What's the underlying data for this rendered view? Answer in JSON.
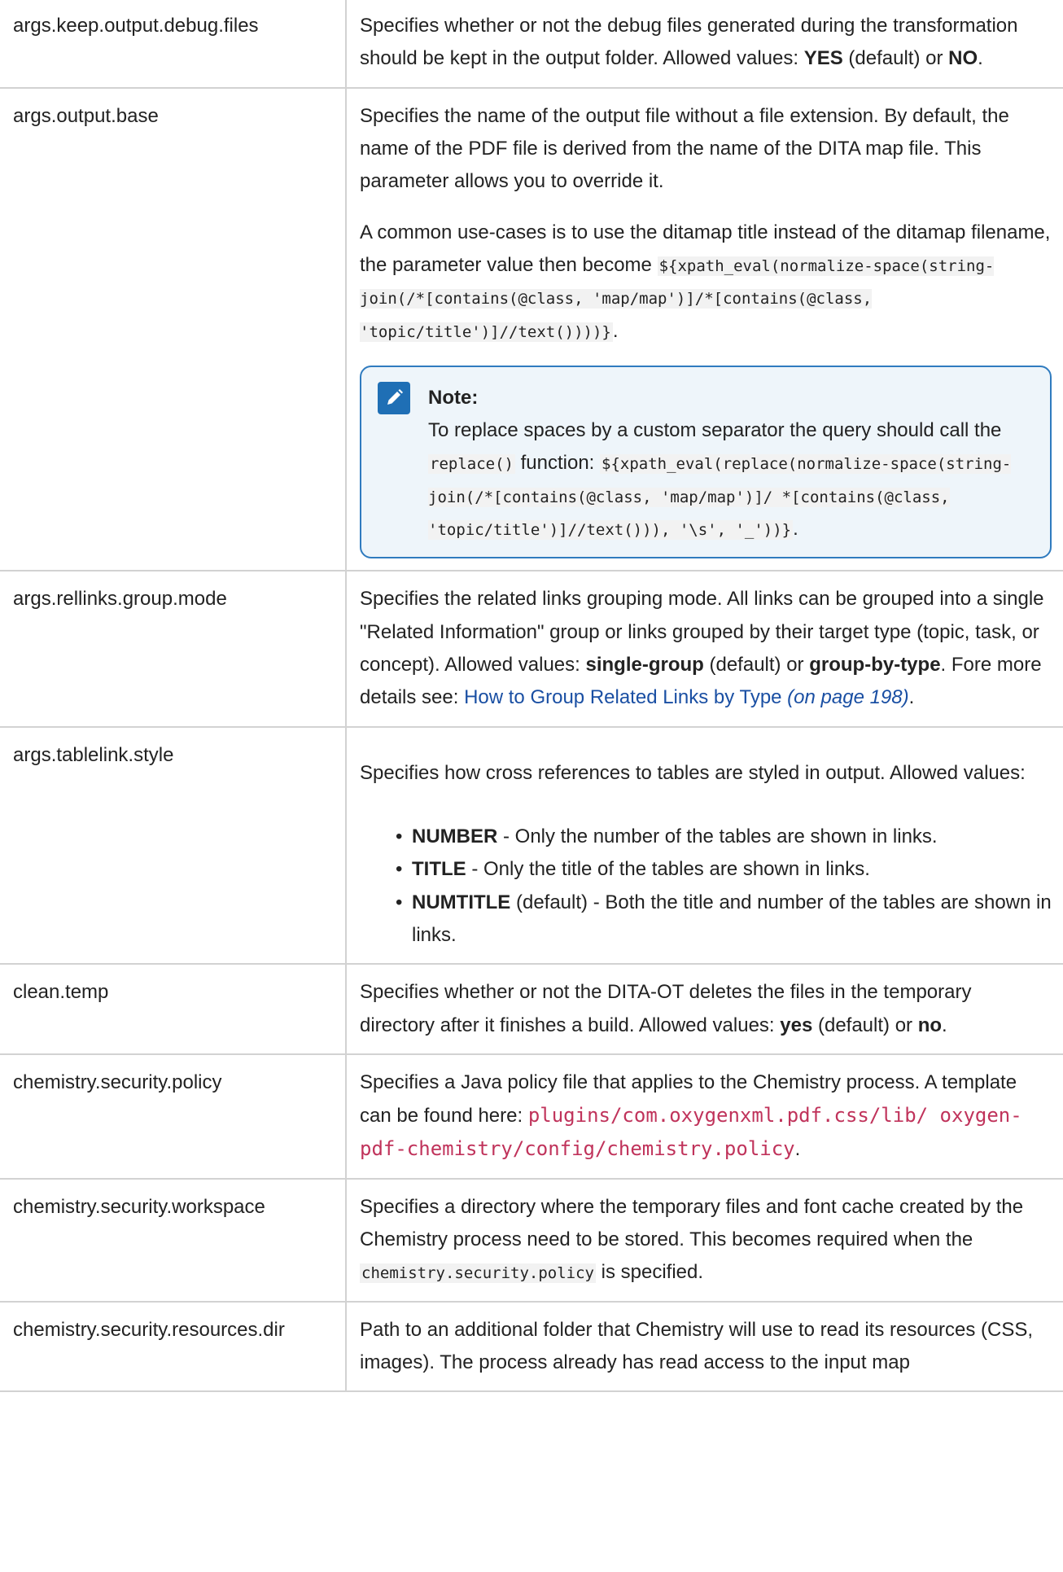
{
  "rows": [
    {
      "name": "args.keep.output.debug.files",
      "desc_pre": "Specifies whether or not the debug files generated during the transfor­mation should be kept in the output folder. Allowed values: ",
      "v1": "YES",
      "mid": " (default) or ",
      "v2": "NO",
      "end": "."
    },
    {
      "name": "args.output.base",
      "p1": "Specifies the name of the output file without a file extension. By default, the name of the PDF file is derived from the name of the DITA map file. This parameter allows you to override it.",
      "p2_text": "A common use-cases is to use the ditamap title instead of the dita­map filename, the parameter value then become ",
      "p2_code": "${xpath_eval(normal­ize-space(string-join(/*[contains(@class, 'map/map')]/*[contain­s(@class, 'topic/title')]//text())))}",
      "p2_end": ".",
      "note": {
        "title": "Note:",
        "text1": "To replace spaces by a custom separator the query should call the ",
        "code1": "replace()",
        "text2": " function: ",
        "code2": "${xpath_eval(replace(normal­ize-space(string-join(/*[contains(@class, 'map/map')]/ *[contains(@class, 'topic/title')]//text())), '\\s', '_'))}",
        "end": "."
      }
    },
    {
      "name": "args.rellinks.group.mode",
      "t1": "Specifies the related links grouping mode. All links can be grouped into a single \"Related Information\" group or links grouped by their target type (topic, task, or concept). Allowed values: ",
      "v1": "single-group",
      "t2": " (default) or ",
      "v2": "group-by-type",
      "t3": ". Fore more details see: ",
      "link": "How to Group Related Links by Type",
      "page": " (on page 198)",
      "end": "."
    },
    {
      "name": "args.tablelink.style",
      "intro": "Specifies how cross references to tables are styled in output. Allowed values:",
      "items": [
        {
          "key": "NUMBER",
          "text": " - Only the number of the tables are shown in links."
        },
        {
          "key": "TITLE",
          "text": " - Only the title of the tables are shown in links."
        },
        {
          "key": "NUMTITLE",
          "text": " (default) - Both the title and number of the tables are shown in links."
        }
      ]
    },
    {
      "name": "clean.temp",
      "t1": "Specifies whether or not the DITA-OT deletes the files in the temporary directory after it finishes a build. Allowed values: ",
      "v1": "yes",
      "t2": " (default) or ",
      "v2": "no",
      "end": "."
    },
    {
      "name": "chemistry.security.policy",
      "t1": "Specifies a Java policy file that applies to the Chemistry process. A tem­plate can be found here: ",
      "path": "plugins/com.oxygenxml.pdf.css/lib/ oxygen-pdf-chemistry/config/chemistry.policy",
      "end": "."
    },
    {
      "name": "chemistry.security.workspace",
      "t1": "Specifies a directory where the temporary files and font cache created by the Chemistry process need to be stored. This becomes required when the ",
      "code": "chemistry.security.policy",
      "t2": " is specified."
    },
    {
      "name": "chemistry.security.resources.dir",
      "t1": "Path to an additional folder that Chemistry will use to read its resources (CSS, images). The process already has read access to the input map"
    }
  ]
}
